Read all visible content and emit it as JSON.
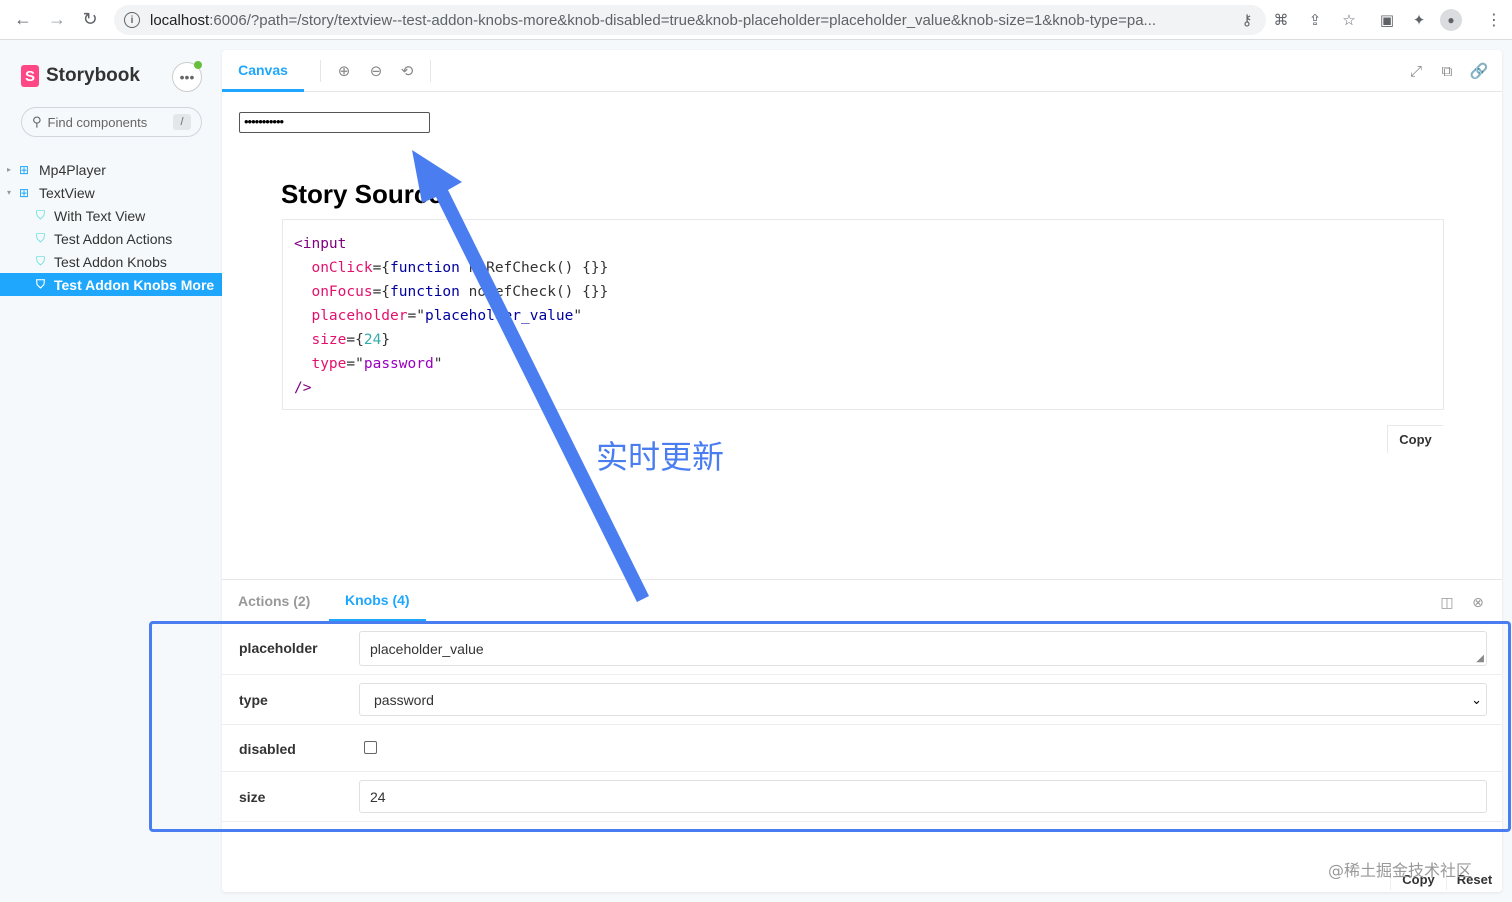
{
  "browser": {
    "url_host": "localhost",
    "url_rest": ":6006/?path=/story/textview--test-addon-knobs-more&knob-disabled=true&knob-placeholder=placeholder_value&knob-size=1&knob-type=pa..."
  },
  "sidebar": {
    "brand": "Storybook",
    "search_placeholder": "Find components",
    "search_shortcut": "/",
    "items": [
      {
        "label": "Mp4Player",
        "type": "component"
      },
      {
        "label": "TextView",
        "type": "component"
      },
      {
        "label": "With Text View",
        "type": "story"
      },
      {
        "label": "Test Addon Actions",
        "type": "story"
      },
      {
        "label": "Test Addon Knobs",
        "type": "story"
      },
      {
        "label": "Test Addon Knobs More",
        "type": "story",
        "selected": true
      }
    ]
  },
  "toolbar": {
    "canvas_tab": "Canvas"
  },
  "preview": {
    "password_value": "•••••••••••",
    "story_title": "Story Source",
    "copy_label": "Copy",
    "code": {
      "open": "<input",
      "onclick_attr": "onClick",
      "onfocus_attr": "onFocus",
      "placeholder_attr": "placeholder",
      "size_attr": "size",
      "type_attr": "type",
      "function_kw": "function",
      "fn_name": "noRefCheck",
      "fn_tail": "() {}",
      "placeholder_val": "placeholder_value",
      "size_val": "24",
      "type_val": "password",
      "close": "/>"
    }
  },
  "addons": {
    "actions_tab": "Actions (2)",
    "knobs_tab": "Knobs (4)",
    "knobs": [
      {
        "label": "placeholder",
        "value": "placeholder_value"
      },
      {
        "label": "type",
        "value": "password"
      },
      {
        "label": "disabled",
        "checked": false
      },
      {
        "label": "size",
        "value": "24"
      }
    ],
    "copy_label": "Copy",
    "reset_label": "Reset"
  },
  "annotation": {
    "text": "实时更新",
    "color": "#4a7ef0"
  },
  "watermark": "@稀土掘金技术社区",
  "colors": {
    "accent": "#1ea7fd",
    "brand": "#ff4785",
    "highlight": "#4a7ef0"
  }
}
